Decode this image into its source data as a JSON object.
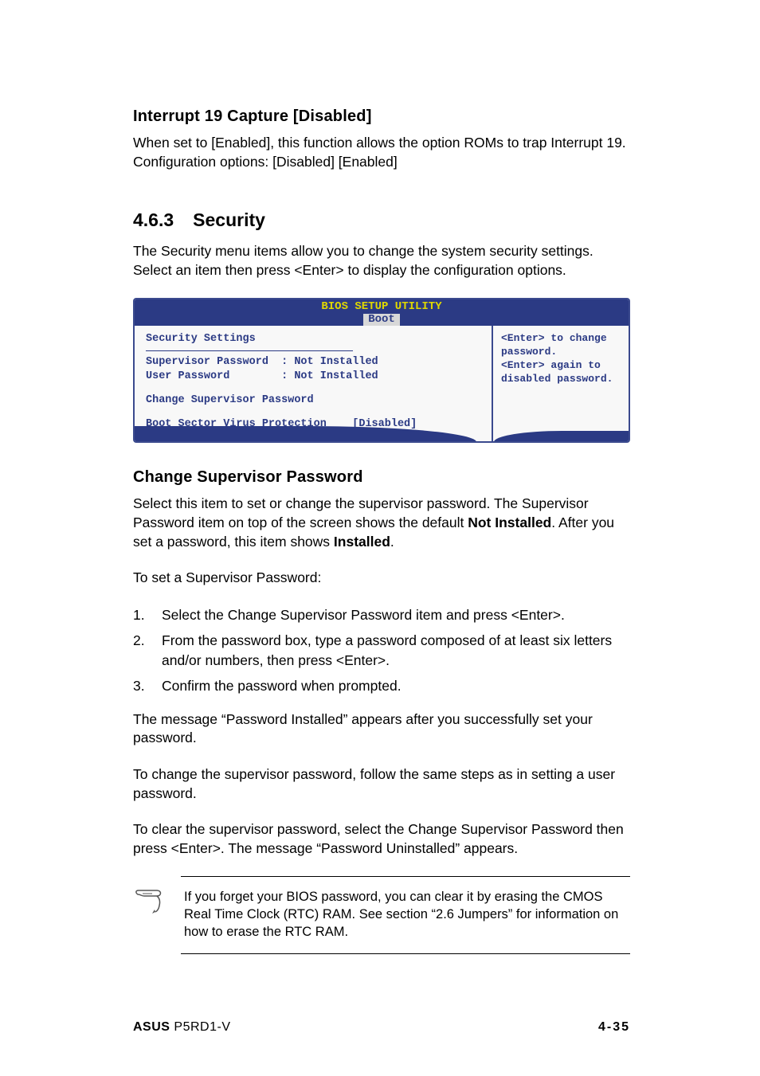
{
  "section1": {
    "heading": "Interrupt 19 Capture [Disabled]",
    "body": "When set to [Enabled], this function allows the option ROMs to trap Interrupt 19. Configuration options: [Disabled] [Enabled]"
  },
  "section2": {
    "number": "4.6.3",
    "title": "Security",
    "intro": "The Security menu items allow you to change the system security settings. Select an item then press <Enter> to display the configuration options."
  },
  "bios": {
    "title": "BIOS SETUP UTILITY",
    "tab": "Boot",
    "left": {
      "header": "Security Settings",
      "rows": [
        "Supervisor Password  : Not Installed",
        "User Password        : Not Installed"
      ],
      "change_pw": "Change Supervisor Password",
      "boot_sector": "Boot Sector Virus Protection    [Disabled]"
    },
    "right": "<Enter> to change password.\n<Enter> again to disabled password."
  },
  "section3": {
    "heading": "Change Supervisor Password",
    "p1_a": "Select this item to set or change the supervisor password. The Supervisor Password item on top of the screen shows the default ",
    "p1_b": "Not Installed",
    "p1_c": ". After you set a password, this item shows ",
    "p1_d": "Installed",
    "p1_e": ".",
    "p2": "To set a Supervisor Password:",
    "steps": [
      "Select the Change Supervisor Password item and press <Enter>.",
      "From the password box, type a password composed of at least six letters and/or numbers, then press <Enter>.",
      "Confirm the password when prompted."
    ],
    "p3": "The message “Password Installed” appears after you successfully set your password.",
    "p4": "To change the supervisor password, follow the same steps as in setting a user password.",
    "p5": "To clear the supervisor password, select the Change Supervisor Password then press <Enter>. The message “Password Uninstalled” appears."
  },
  "note": "If you forget your BIOS password, you can clear it by erasing the CMOS Real Time Clock (RTC) RAM. See section “2.6  Jumpers” for information on how to erase the RTC RAM.",
  "footer": {
    "brand": "ASUS",
    "model": "P5RD1-V",
    "page": "4-35"
  }
}
